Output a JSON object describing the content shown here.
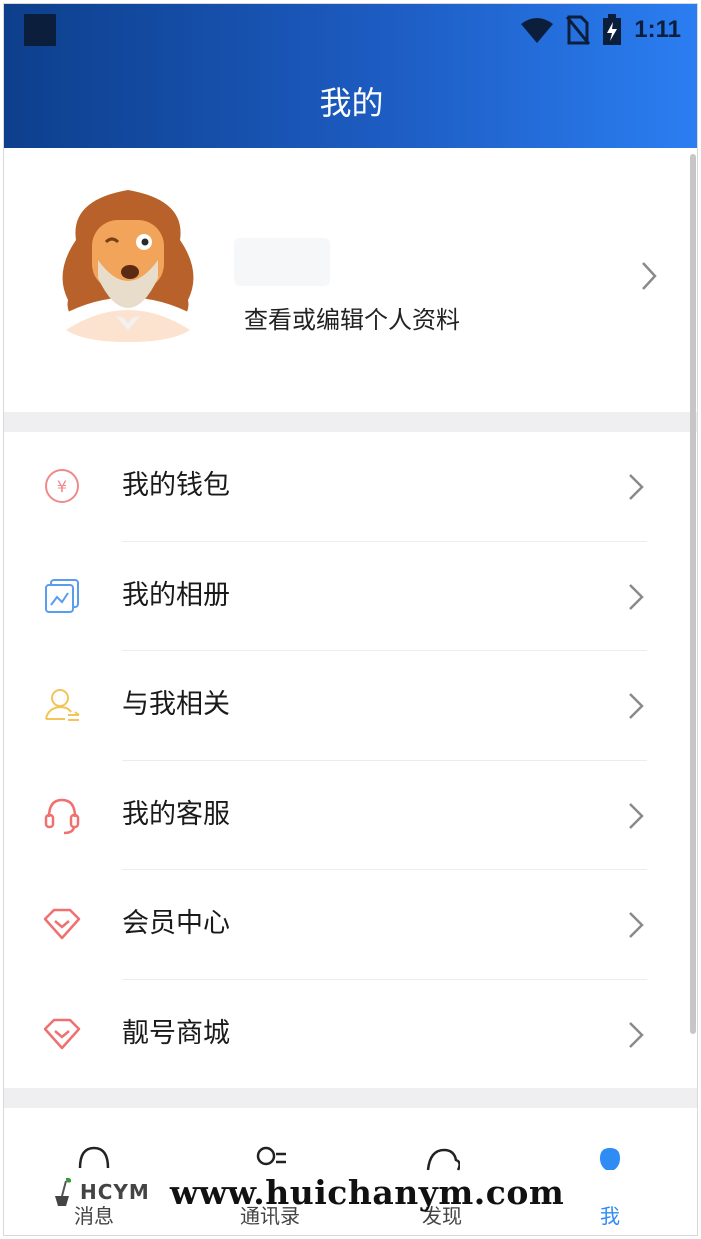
{
  "status_bar": {
    "time": "1:11"
  },
  "header": {
    "title": "我的"
  },
  "profile": {
    "subtitle": "查看或编辑个人资料"
  },
  "menu": [
    {
      "label": "我的钱包",
      "icon": "wallet-icon",
      "color": "#f08a8a"
    },
    {
      "label": "我的相册",
      "icon": "album-icon",
      "color": "#5a9cf0"
    },
    {
      "label": "与我相关",
      "icon": "related-person-icon",
      "color": "#f2c45a"
    },
    {
      "label": "我的客服",
      "icon": "headset-icon",
      "color": "#f07070"
    },
    {
      "label": "会员中心",
      "icon": "member-diamond-icon",
      "color": "#f07070"
    },
    {
      "label": "靓号商城",
      "icon": "number-store-diamond-icon",
      "color": "#f07070"
    }
  ],
  "bottom_nav": [
    {
      "label": "消息",
      "icon": "chat-icon"
    },
    {
      "label": "通讯录",
      "icon": "contacts-icon"
    },
    {
      "label": "发现",
      "icon": "discover-icon"
    },
    {
      "label": "我",
      "icon": "me-icon"
    }
  ],
  "watermark": {
    "logo": "HCYM",
    "url": "www.huichanym.com"
  },
  "colors": {
    "header_start": "#0d3f8c",
    "header_end": "#2b7ef2",
    "active_tab": "#2f8cf5"
  }
}
